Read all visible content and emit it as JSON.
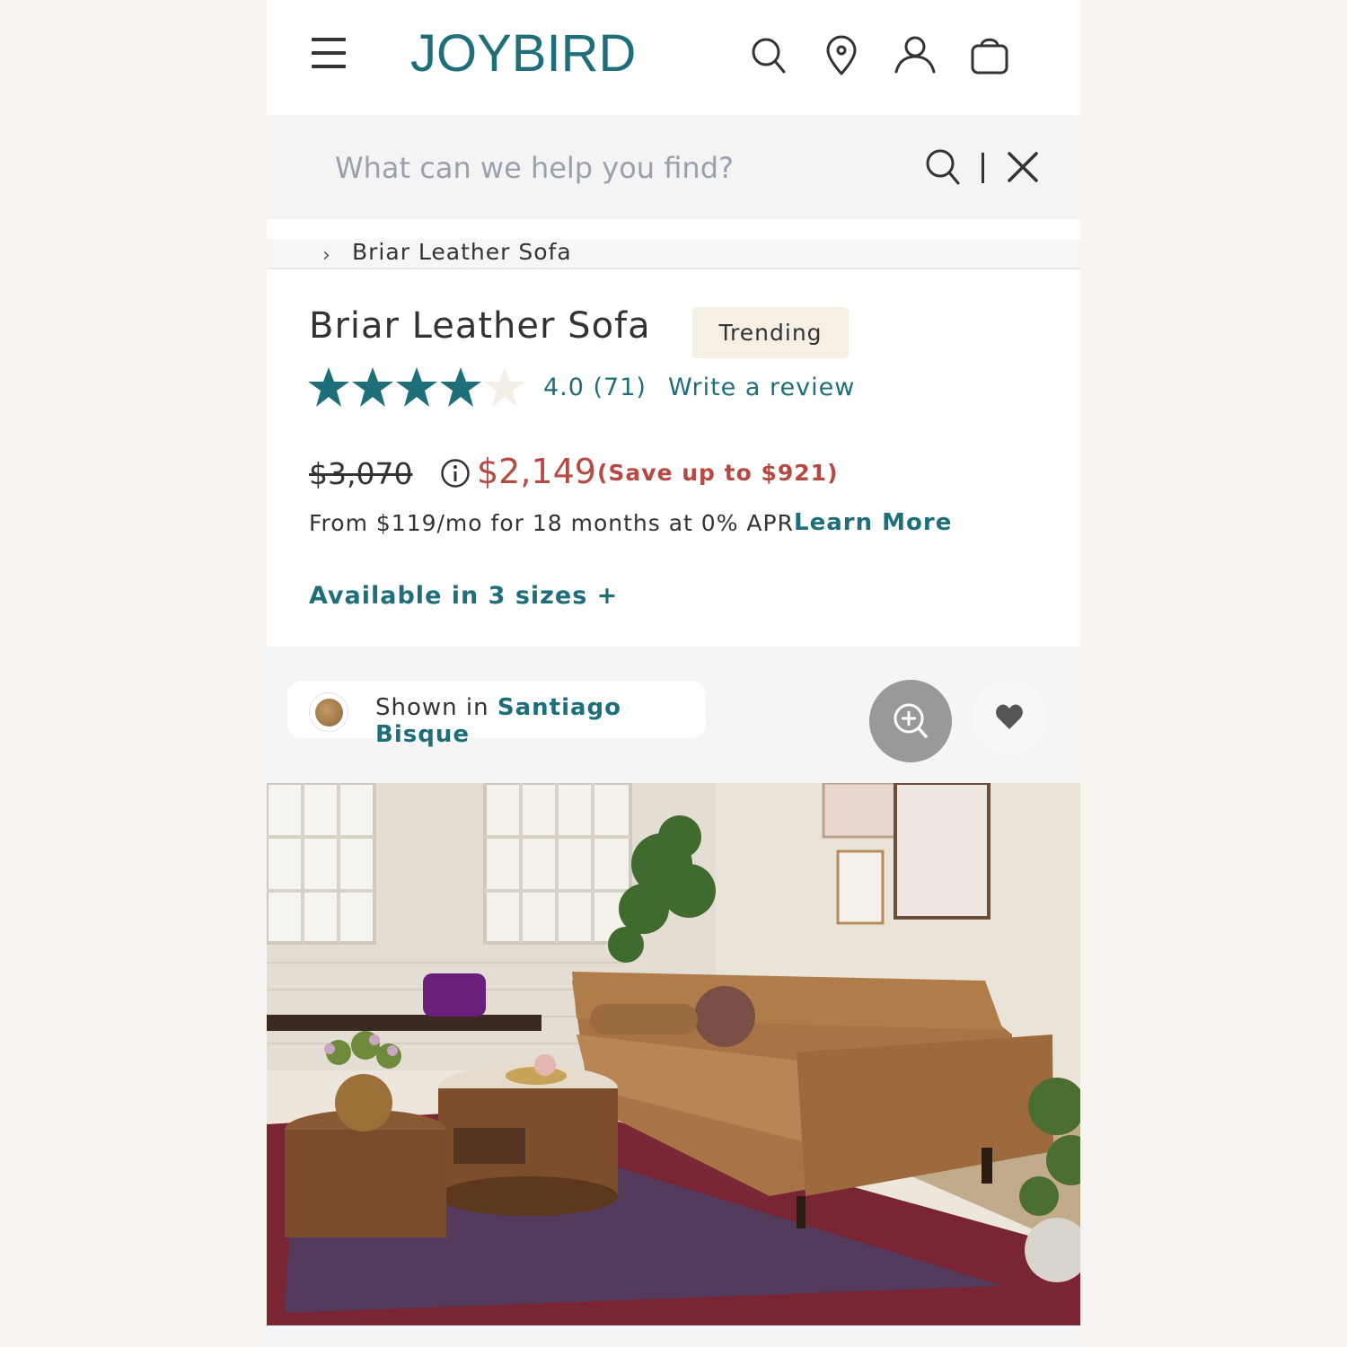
{
  "header": {
    "logo": "JOYBIRD",
    "icons": [
      "menu-icon",
      "search-icon",
      "location-pin-icon",
      "user-icon",
      "shopping-bag-icon"
    ]
  },
  "search": {
    "placeholder": "What can we help you find?",
    "value": ""
  },
  "breadcrumb": {
    "current": "Briar Leather Sofa"
  },
  "product": {
    "title": "Briar Leather Sofa",
    "badge": "Trending",
    "rating_value": 4.0,
    "rating_text": "4.0 (71)",
    "write_review": "Write a review",
    "original_price": "$3,070",
    "sale_price": "$2,149",
    "savings": "(Save up to $921)",
    "financing": "From $119/mo for 18 months at 0% APR",
    "learn_more": "Learn More",
    "sizes": "Available in 3 sizes +"
  },
  "gallery": {
    "shown_prefix": "Shown in ",
    "color_name": "Santiago Bisque",
    "zoom_icon": "zoom-in-icon",
    "favorite_icon": "heart-icon"
  },
  "colors": {
    "brand_teal": "#1e6f7a",
    "sale_red": "#b64a43",
    "badge_bg": "#f5efe4",
    "star_empty": "#f3efe6"
  }
}
